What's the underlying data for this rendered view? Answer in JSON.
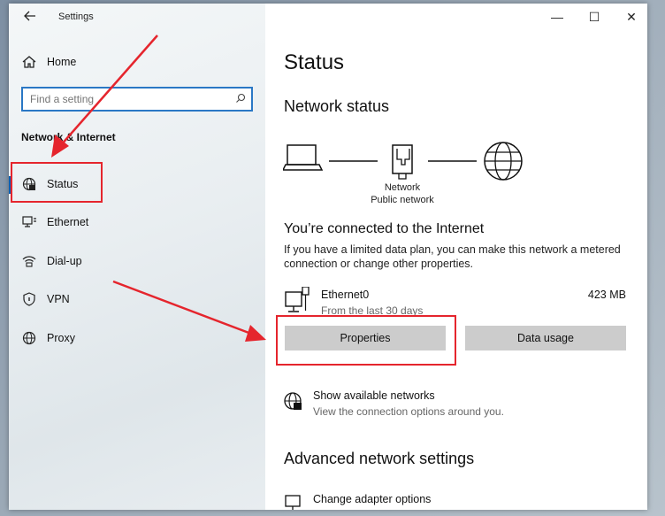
{
  "app": {
    "title": "Settings"
  },
  "sidebar": {
    "home_label": "Home",
    "search_placeholder": "Find a setting",
    "section_label": "Network & Internet",
    "items": [
      {
        "label": "Status",
        "icon": "globe-icon",
        "active": true
      },
      {
        "label": "Ethernet",
        "icon": "ethernet-icon",
        "active": false
      },
      {
        "label": "Dial-up",
        "icon": "dialup-icon",
        "active": false
      },
      {
        "label": "VPN",
        "icon": "vpn-icon",
        "active": false
      },
      {
        "label": "Proxy",
        "icon": "globe-icon",
        "active": false
      }
    ]
  },
  "window_controls": {
    "minimize": "—",
    "maximize": "☐",
    "close": "✕"
  },
  "main": {
    "title": "Status",
    "network_status_heading": "Network status",
    "diagram": {
      "network_name": "Network",
      "network_type": "Public network"
    },
    "connected_heading": "You’re connected to the Internet",
    "description": "If you have a limited data plan, you can make this network a metered connection or change other properties.",
    "adapter": {
      "name": "Ethernet0",
      "subtitle": "From the last 30 days",
      "usage": "423 MB"
    },
    "buttons": {
      "properties": "Properties",
      "data_usage": "Data usage"
    },
    "show_networks": {
      "title": "Show available networks",
      "subtitle": "View the connection options around you."
    },
    "advanced_heading": "Advanced network settings",
    "change_adapter": {
      "title": "Change adapter options"
    }
  },
  "colors": {
    "accent": "#0b5fb3",
    "highlight_box": "#e5252d",
    "button_bg": "#cccccc"
  }
}
